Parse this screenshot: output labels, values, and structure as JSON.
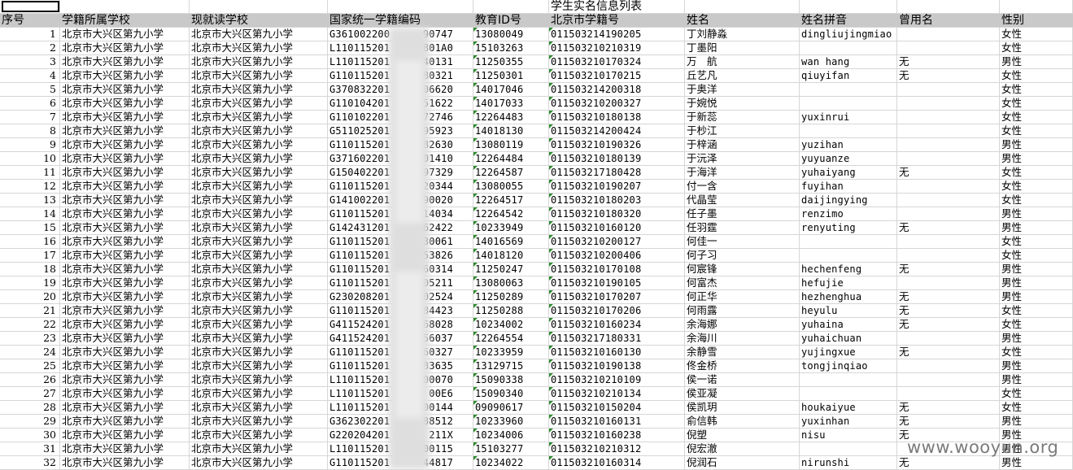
{
  "sheet_title": "学生实名信息列表",
  "headers": [
    "序号",
    "学籍所属学校",
    "现就读学校",
    "国家统一学籍编码",
    "教育ID号",
    "北京市学籍号",
    "姓名",
    "姓名拼音",
    "曾用名",
    "性别"
  ],
  "rows": [
    [
      "1",
      "北京市大兴区第九小学",
      "北京市大兴区第九小学",
      "G361002200",
      "90747",
      "13080049",
      "011503214190205",
      "丁刘静淼",
      "dingliujingmiao",
      "",
      "女性"
    ],
    [
      "2",
      "北京市大兴区第九小学",
      "北京市大兴区第九小学",
      "L110115201",
      "801A0",
      "15103263",
      "011503210210319",
      "丁墨阳",
      "",
      "",
      "女性"
    ],
    [
      "3",
      "北京市大兴区第九小学",
      "北京市大兴区第九小学",
      "L110115201",
      "40131",
      "11250355",
      "011503210170324",
      "万　航",
      "wan hang",
      "无",
      "男性"
    ],
    [
      "4",
      "北京市大兴区第九小学",
      "北京市大兴区第九小学",
      "G110115201",
      "80321",
      "11250301",
      "011503210170215",
      "丘艺凡",
      "qiuyifan",
      "无",
      "女性"
    ],
    [
      "5",
      "北京市大兴区第九小学",
      "北京市大兴区第九小学",
      "G370832201",
      "06620",
      "14017046",
      "011503214200318",
      "于奥洋",
      "",
      "",
      "女性"
    ],
    [
      "6",
      "北京市大兴区第九小学",
      "北京市大兴区第九小学",
      "G110104201",
      "51622",
      "14017033",
      "011503210200327",
      "于婉悦",
      "",
      "",
      "女性"
    ],
    [
      "7",
      "北京市大兴区第九小学",
      "北京市大兴区第九小学",
      "G110102201",
      "72746",
      "12264483",
      "011503210180138",
      "于新蕊",
      "yuxinrui",
      "",
      "女性"
    ],
    [
      "8",
      "北京市大兴区第九小学",
      "北京市大兴区第九小学",
      "G511025201",
      "95923",
      "14018130",
      "011503214200424",
      "于杪江",
      "",
      "",
      "女性"
    ],
    [
      "9",
      "北京市大兴区第九小学",
      "北京市大兴区第九小学",
      "G110115201",
      "82630",
      "13080119",
      "011503210190326",
      "于梓涵",
      "yuzihan",
      "",
      "男性"
    ],
    [
      "10",
      "北京市大兴区第九小学",
      "北京市大兴区第九小学",
      "G371602201",
      "01410",
      "12264484",
      "011503210180139",
      "于沅泽",
      "yuyuanze",
      "",
      "男性"
    ],
    [
      "11",
      "北京市大兴区第九小学",
      "北京市大兴区第九小学",
      "G150402201",
      "97329",
      "12264587",
      "011503217180428",
      "于海洋",
      "yuhaiyang",
      "无",
      "女性"
    ],
    [
      "12",
      "北京市大兴区第九小学",
      "北京市大兴区第九小学",
      "G110115201",
      "20344",
      "13080055",
      "011503210190207",
      "付一含",
      "fuyihan",
      "",
      "女性"
    ],
    [
      "13",
      "北京市大兴区第九小学",
      "北京市大兴区第九小学",
      "G141002201",
      "90020",
      "12264517",
      "011503210180203",
      "代晶莹",
      "daijingying",
      "",
      "女性"
    ],
    [
      "14",
      "北京市大兴区第九小学",
      "北京市大兴区第九小学",
      "G110115201",
      "14034",
      "12264542",
      "011503210180320",
      "任子墨",
      "renzimo",
      "",
      "男性"
    ],
    [
      "15",
      "北京市大兴区第九小学",
      "北京市大兴区第九小学",
      "G142431201",
      "62422",
      "10233949",
      "011503210160120",
      "任羽霆",
      "renyuting",
      "无",
      "男性"
    ],
    [
      "16",
      "北京市大兴区第九小学",
      "北京市大兴区第九小学",
      "G110115201",
      "30061",
      "14016569",
      "011503210200127",
      "何佳一",
      "",
      "",
      "女性"
    ],
    [
      "17",
      "北京市大兴区第九小学",
      "北京市大兴区第九小学",
      "G110115201",
      "53826",
      "14018120",
      "011503210200406",
      "何子习",
      "",
      "",
      "女性"
    ],
    [
      "18",
      "北京市大兴区第九小学",
      "北京市大兴区第九小学",
      "G110115201",
      "60314",
      "11250247",
      "011503210170108",
      "何宸锋",
      "hechenfeng",
      "无",
      "男性"
    ],
    [
      "19",
      "北京市大兴区第九小学",
      "北京市大兴区第九小学",
      "G110115201",
      "05211",
      "13080063",
      "011503210190105",
      "何富杰",
      "hefujie",
      "",
      "男性"
    ],
    [
      "20",
      "北京市大兴区第九小学",
      "北京市大兴区第九小学",
      "G230208201",
      "02524",
      "11250289",
      "011503210170207",
      "何正华",
      "hezhenghua",
      "无",
      "男性"
    ],
    [
      "21",
      "北京市大兴区第九小学",
      "北京市大兴区第九小学",
      "G110115201",
      "84423",
      "11250288",
      "011503210170206",
      "何雨露",
      "heyulu",
      "无",
      "女性"
    ],
    [
      "22",
      "北京市大兴区第九小学",
      "北京市大兴区第九小学",
      "G411524201",
      "68028",
      "10234002",
      "011503210160234",
      "余海娜",
      "yuhaina",
      "无",
      "女性"
    ],
    [
      "23",
      "北京市大兴区第九小学",
      "北京市大兴区第九小学",
      "G411524201",
      "56037",
      "12264554",
      "011503217180331",
      "余海川",
      "yuhaichuan",
      "",
      "男性"
    ],
    [
      "24",
      "北京市大兴区第九小学",
      "北京市大兴区第九小学",
      "G110115201",
      "60327",
      "10233959",
      "011503210160130",
      "余静雪",
      "yujingxue",
      "无",
      "女性"
    ],
    [
      "25",
      "北京市大兴区第九小学",
      "北京市大兴区第九小学",
      "G110115201",
      "83635",
      "13129715",
      "011503210190138",
      "佟金桥",
      "tongjinqiao",
      "",
      "男性"
    ],
    [
      "26",
      "北京市大兴区第九小学",
      "北京市大兴区第九小学",
      "L110115201",
      "00070",
      "15090338",
      "011503210210109",
      "侯一诺",
      "",
      "",
      "男性"
    ],
    [
      "27",
      "北京市大兴区第九小学",
      "北京市大兴区第九小学",
      "L110115201",
      "00E6",
      "15090340",
      "011503210210134",
      "侯亚凝",
      "",
      "",
      "女性"
    ],
    [
      "28",
      "北京市大兴区第九小学",
      "北京市大兴区第九小学",
      "L110115201",
      "00144",
      "09090617",
      "011503210150204",
      "侯凯玥",
      "houkaiyue",
      "无",
      "女性"
    ],
    [
      "29",
      "北京市大兴区第九小学",
      "北京市大兴区第九小学",
      "G362302201",
      "88512",
      "10233960",
      "011503210160131",
      "俞信韩",
      "yuxinhan",
      "无",
      "男性"
    ],
    [
      "30",
      "北京市大兴区第九小学",
      "北京市大兴区第九小学",
      "G220204201",
      "211X",
      "10234006",
      "011503210160238",
      "倪塑",
      "nisu",
      "无",
      "男性"
    ],
    [
      "31",
      "北京市大兴区第九小学",
      "北京市大兴区第九小学",
      "L110115201",
      "00115",
      "15103277",
      "011503210210312",
      "倪宏澈",
      "",
      "",
      "男性"
    ],
    [
      "32",
      "北京市大兴区第九小学",
      "北京市大兴区第九小学",
      "G110115201",
      "44817",
      "10234022",
      "011503210160314",
      "倪润石",
      "nirunshi",
      "无",
      "男性"
    ]
  ],
  "watermark": "www.wooyun.org"
}
